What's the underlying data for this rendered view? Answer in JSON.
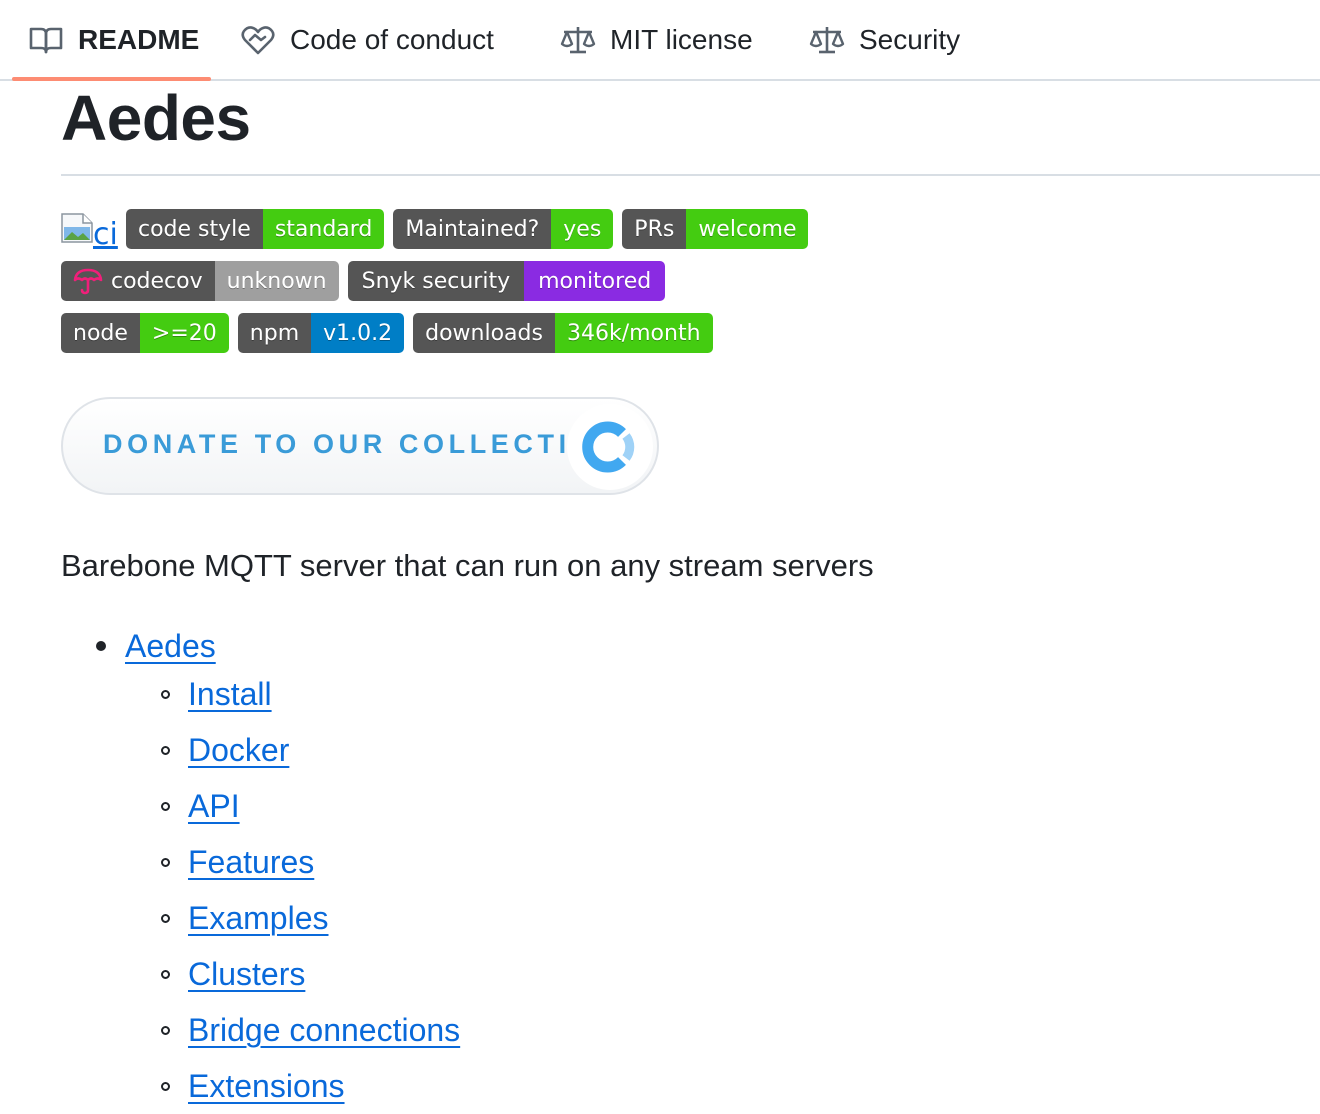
{
  "tabs": [
    {
      "label": "README",
      "icon": "book-icon",
      "active": true
    },
    {
      "label": "Code of conduct",
      "icon": "code-of-conduct-icon",
      "active": false
    },
    {
      "label": "MIT license",
      "icon": "law-scale-icon",
      "active": false
    },
    {
      "label": "Security",
      "icon": "law-scale-icon",
      "active": false
    }
  ],
  "readme": {
    "title": "Aedes",
    "broken_image_alt": "ci",
    "badges_row1": [
      {
        "label": "code style",
        "value": "standard",
        "value_color": "#4c1"
      },
      {
        "label": "Maintained?",
        "value": "yes",
        "value_color": "#4c1"
      },
      {
        "label": "PRs",
        "value": "welcome",
        "value_color": "#4c1"
      }
    ],
    "badges_row2": [
      {
        "label": "codecov",
        "value": "unknown",
        "value_color": "#9f9f9f",
        "icon": "codecov-umbrella-icon"
      },
      {
        "label": "Snyk security",
        "value": "monitored",
        "value_color": "#8a2be2"
      }
    ],
    "badges_row3": [
      {
        "label": "node",
        "value": ">=20",
        "value_color": "#4c1"
      },
      {
        "label": "npm",
        "value": "v1.0.2",
        "value_color": "#007ec6"
      },
      {
        "label": "downloads",
        "value": "346k/month",
        "value_color": "#4c1"
      }
    ],
    "donate_label": "DONATE TO OUR COLLECTIVE",
    "description": "Barebone MQTT server that can run on any stream servers",
    "toc": {
      "top": "Aedes",
      "items": [
        "Install",
        "Docker",
        "API",
        "Features",
        "Examples",
        "Clusters",
        "Bridge connections",
        "Extensions"
      ]
    }
  },
  "colors": {
    "link": "#0969da",
    "tab_underline": "#fd8c73",
    "badge_label_bg": "#555555",
    "donate_text": "#3a9bd8"
  }
}
